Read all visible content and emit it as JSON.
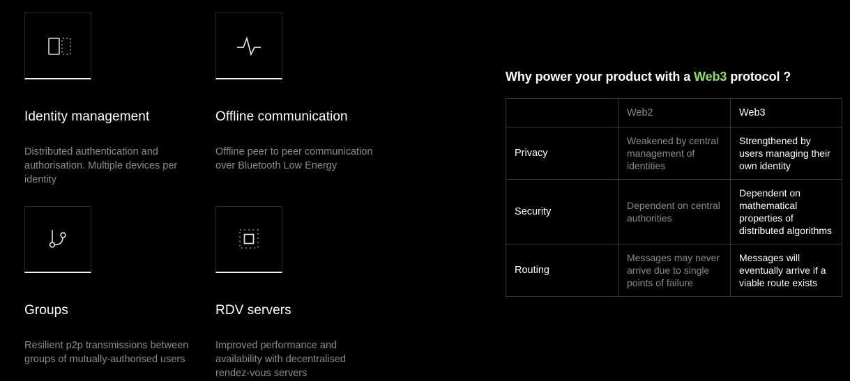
{
  "features": [
    {
      "icon": "identity-devices-icon",
      "title": "Identity management",
      "desc": "Distributed authentication and authorisation. Multiple devices per identity"
    },
    {
      "icon": "pulse-wave-icon",
      "title": "Offline communication",
      "desc": "Offline peer to peer communication over Bluetooth Low Energy"
    },
    {
      "icon": "node-graph-icon",
      "title": "Groups",
      "desc": "Resilient p2p transmissions between groups of mutually-authorised users"
    },
    {
      "icon": "server-grid-icon",
      "title": "RDV servers",
      "desc": "Improved performance and availability with decentralised rendez-vous servers"
    }
  ],
  "panel": {
    "heading_before": "Why power your product with a ",
    "heading_accent": "Web3",
    "heading_after": " protocol ?",
    "accent_color": "#8ce563",
    "table": {
      "headers": [
        "",
        "Web2",
        "Web3"
      ],
      "rows": [
        {
          "label": "Privacy",
          "web2": "Weakened by central management of identities",
          "web3": "Strengthened by users managing their own identity"
        },
        {
          "label": "Security",
          "web2": "Dependent on central authorities",
          "web3": "Dependent on mathematical properties of distributed algorithms"
        },
        {
          "label": "Routing",
          "web2": "Messages may never arrive due to single points of failure",
          "web3": "Messages will eventually arrive if a viable route exists"
        }
      ]
    }
  }
}
